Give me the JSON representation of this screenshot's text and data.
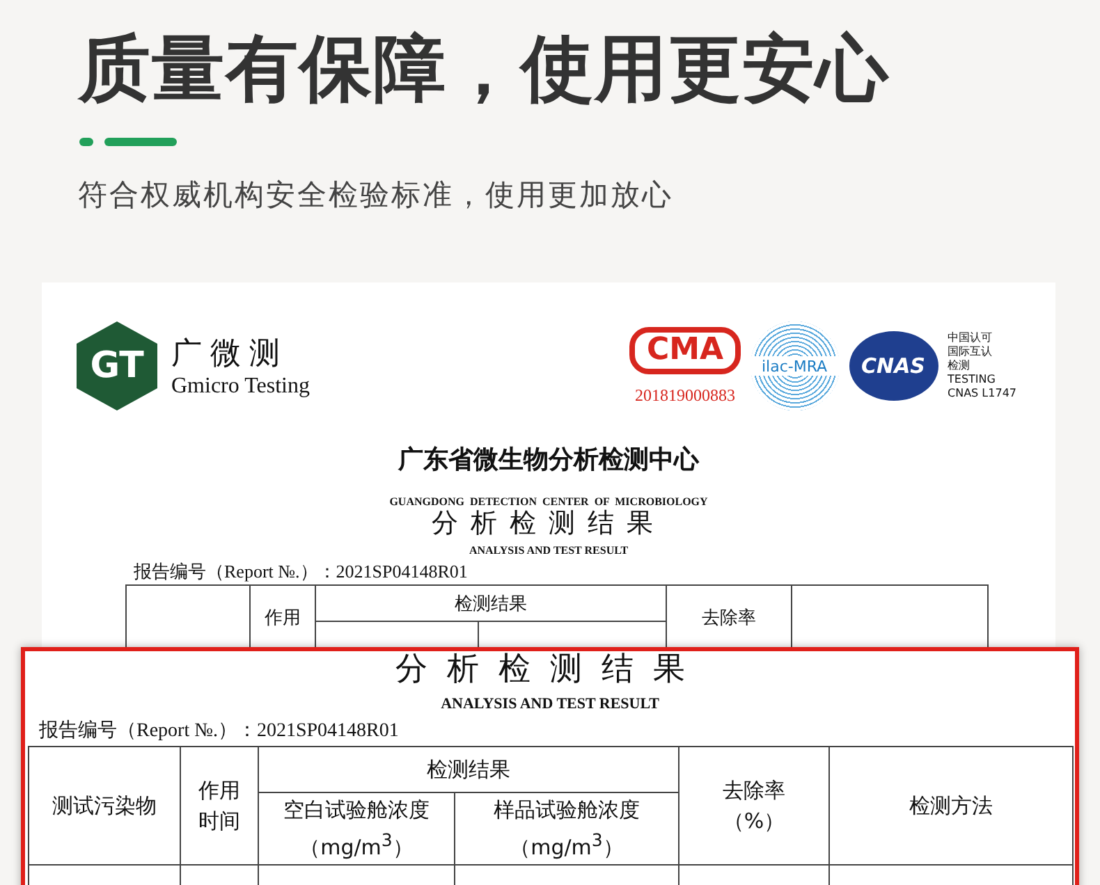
{
  "headline": "质量有保障，使用更安心",
  "subtitle": "符合权威机构安全检验标准，使用更加放心",
  "report": {
    "logo_mark": "GT",
    "logo_cn": "广微测",
    "logo_en": "Gmicro Testing",
    "cma_mark": "CMA",
    "cma_number": "201819000883",
    "ilac_mark": "ilac-MRA",
    "cnas_mark": "CNAS",
    "cnas_lines": [
      "中国认可",
      "国际互认",
      "检测",
      "TESTING",
      "CNAS L1747"
    ],
    "title_cn": "广东省微生物分析检测中心",
    "title_en": "GUANGDONG  DETECTION  CENTER  OF  MICROBIOLOGY",
    "heading_cn": "分析检测结果",
    "heading_en": "ANALYSIS AND TEST RESULT",
    "report_no": "报告编号（Report №.）：2021SP04148R01",
    "table_headers": {
      "time": "作用",
      "results": "检测结果",
      "removal": "去除率"
    }
  },
  "zoom": {
    "heading_cn": "分析检测结果",
    "heading_en": "ANALYSIS AND TEST RESULT",
    "report_no": "报告编号（Report №.）：2021SP04148R01",
    "headers": {
      "pollutant": "测试污染物",
      "time": [
        "作用",
        "时间"
      ],
      "results": "检测结果",
      "blank": [
        "空白试验舱浓度",
        "（mg/m$^{3}$）"
      ],
      "sample": [
        "样品试验舱浓度",
        "（mg/m$^{3}$）"
      ],
      "removal": [
        "去除率",
        "（%）"
      ],
      "method": "检测方法"
    }
  }
}
